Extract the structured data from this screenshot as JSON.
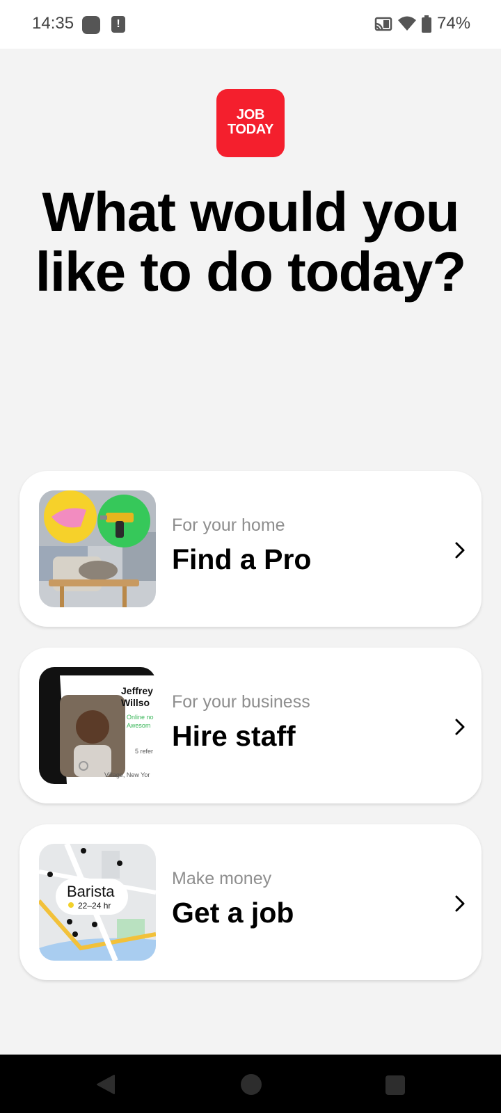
{
  "status_bar": {
    "time": "14:35",
    "battery_percent": "74%",
    "icons": [
      "notification-dot-icon",
      "alert-icon",
      "cast-icon",
      "wifi-icon",
      "battery-icon"
    ]
  },
  "logo": {
    "line1": "JOB",
    "line2": "TODAY",
    "color": "#f41f2d"
  },
  "headline": "What would you like to do today?",
  "options": [
    {
      "subtitle": "For your home",
      "title": "Find a Pro"
    },
    {
      "subtitle": "For your business",
      "title": "Hire staff",
      "thumb": {
        "name_line1": "Jeffrey",
        "name_line2": "Willso",
        "status_line1": "Online no",
        "status_line2": "Awesom",
        "refs": "5 refer",
        "location": "Village, New Yor"
      }
    },
    {
      "subtitle": "Make money",
      "title": "Get a job",
      "thumb": {
        "job_title": "Barista",
        "hours": "22–24 hr"
      }
    }
  ],
  "nav_bar": {
    "icons": [
      "back-icon",
      "home-icon",
      "recents-icon"
    ]
  }
}
